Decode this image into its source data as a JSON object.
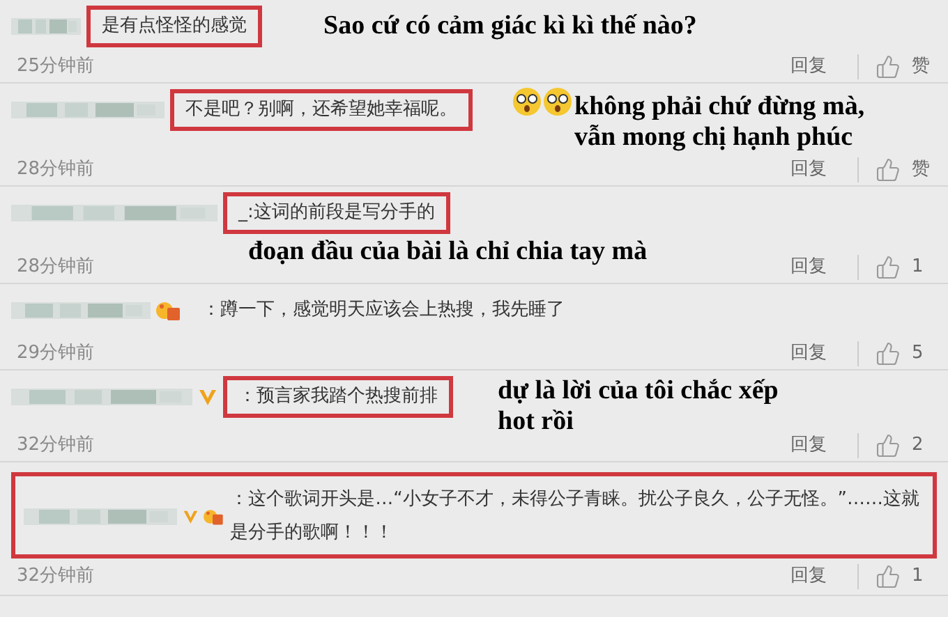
{
  "comments": [
    {
      "text": "是有点怪怪的感觉",
      "highlighted": true,
      "time": "25分钟前",
      "reply": "回复",
      "likes": "赞",
      "annotation": {
        "lines": [
          "Sao cứ có cảm giác kì kì thế nào?"
        ]
      }
    },
    {
      "text": "不是吧？别啊，还希望她幸福呢。",
      "highlighted": true,
      "time": "28分钟前",
      "reply": "回复",
      "likes": "赞",
      "annotation": {
        "lines": [
          "không phải chứ đừng mà,",
          "vẫn mong chị hạnh phúc"
        ],
        "surprised_faces": true
      }
    },
    {
      "text": "_:这词的前段是写分手的",
      "highlighted": true,
      "time": "28分钟前",
      "reply": "回复",
      "likes": "1",
      "annotation": {
        "lines": [
          "đoạn đầu của bài là chỉ chia tay mà"
        ]
      }
    },
    {
      "fan_badge": true,
      "text": "：蹲一下，感觉明天应该会上热搜，我先睡了",
      "highlighted": false,
      "time": "29分钟前",
      "reply": "回复",
      "likes": "5"
    },
    {
      "verified": true,
      "text": "：预言家我踏个热搜前排",
      "highlighted": true,
      "time": "32分钟前",
      "reply": "回复",
      "likes": "2",
      "annotation": {
        "lines": [
          "dự là lời của tôi chắc xếp",
          "hot rồi"
        ]
      }
    },
    {
      "verified": true,
      "fan_badge": true,
      "text": "：这个歌词开头是…“小女子不才，未得公子青睐。扰公子良久，公子无怪。”……这就是分手的歌啊！！！",
      "highlighted": true,
      "highlight_includes_name": true,
      "time": "32分钟前",
      "reply": "回复",
      "likes": "1"
    }
  ]
}
